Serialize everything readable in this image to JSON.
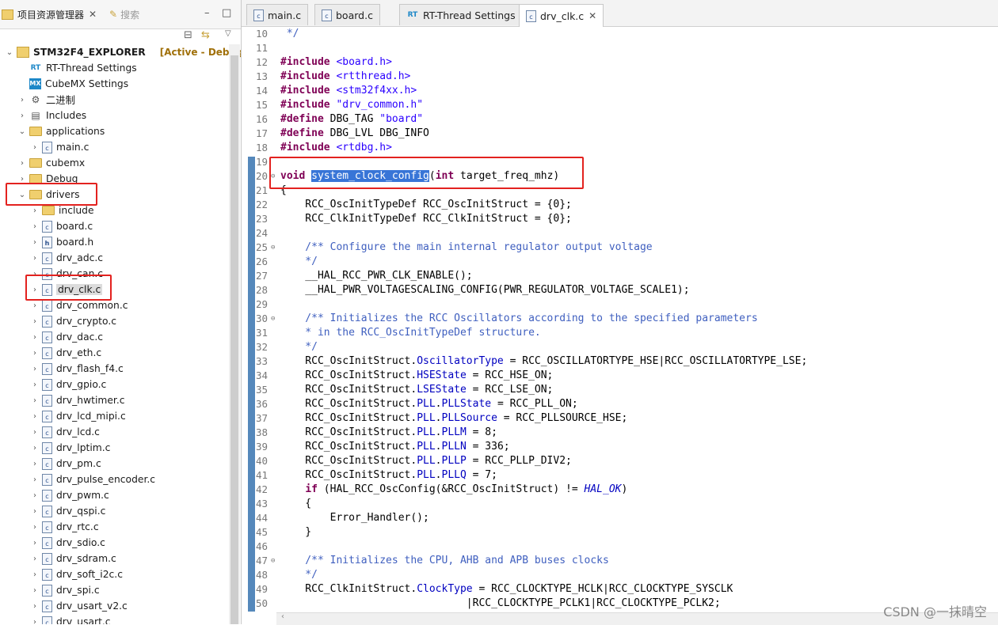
{
  "left_panel": {
    "tab_active": "项目资源管理器",
    "tab_inactive": "搜索",
    "minimize_glyph": "–",
    "maximize_glyph": "□",
    "project_name": "STM32F4_EXPLORER",
    "project_status": "[Active - Debug]",
    "tree": [
      {
        "label": "RT-Thread Settings",
        "kind": "rt",
        "depth": 1,
        "twisty": ""
      },
      {
        "label": "CubeMX Settings",
        "kind": "mx",
        "depth": 1,
        "twisty": ""
      },
      {
        "label": "二进制",
        "kind": "binary",
        "depth": 1,
        "twisty": "›"
      },
      {
        "label": "Includes",
        "kind": "includes",
        "depth": 1,
        "twisty": "›"
      },
      {
        "label": "applications",
        "kind": "folder",
        "depth": 1,
        "twisty": "⌄"
      },
      {
        "label": "main.c",
        "kind": "c",
        "depth": 2,
        "twisty": "›"
      },
      {
        "label": "cubemx",
        "kind": "folder",
        "depth": 1,
        "twisty": "›"
      },
      {
        "label": "Debug",
        "kind": "folder",
        "depth": 1,
        "twisty": "›"
      },
      {
        "label": "drivers",
        "kind": "folder",
        "depth": 1,
        "twisty": "⌄"
      },
      {
        "label": "include",
        "kind": "folder",
        "depth": 2,
        "twisty": "›"
      },
      {
        "label": "board.c",
        "kind": "c",
        "depth": 2,
        "twisty": "›"
      },
      {
        "label": "board.h",
        "kind": "h",
        "depth": 2,
        "twisty": "›"
      },
      {
        "label": "drv_adc.c",
        "kind": "c",
        "depth": 2,
        "twisty": "›"
      },
      {
        "label": "drv_can.c",
        "kind": "c",
        "depth": 2,
        "twisty": "›"
      },
      {
        "label": "drv_clk.c",
        "kind": "c",
        "depth": 2,
        "twisty": "›"
      },
      {
        "label": "drv_common.c",
        "kind": "c",
        "depth": 2,
        "twisty": "›"
      },
      {
        "label": "drv_crypto.c",
        "kind": "c",
        "depth": 2,
        "twisty": "›"
      },
      {
        "label": "drv_dac.c",
        "kind": "c",
        "depth": 2,
        "twisty": "›"
      },
      {
        "label": "drv_eth.c",
        "kind": "c",
        "depth": 2,
        "twisty": "›"
      },
      {
        "label": "drv_flash_f4.c",
        "kind": "c",
        "depth": 2,
        "twisty": "›"
      },
      {
        "label": "drv_gpio.c",
        "kind": "c",
        "depth": 2,
        "twisty": "›"
      },
      {
        "label": "drv_hwtimer.c",
        "kind": "c",
        "depth": 2,
        "twisty": "›"
      },
      {
        "label": "drv_lcd_mipi.c",
        "kind": "c",
        "depth": 2,
        "twisty": "›"
      },
      {
        "label": "drv_lcd.c",
        "kind": "c",
        "depth": 2,
        "twisty": "›"
      },
      {
        "label": "drv_lptim.c",
        "kind": "c",
        "depth": 2,
        "twisty": "›"
      },
      {
        "label": "drv_pm.c",
        "kind": "c",
        "depth": 2,
        "twisty": "›"
      },
      {
        "label": "drv_pulse_encoder.c",
        "kind": "c",
        "depth": 2,
        "twisty": "›"
      },
      {
        "label": "drv_pwm.c",
        "kind": "c",
        "depth": 2,
        "twisty": "›"
      },
      {
        "label": "drv_qspi.c",
        "kind": "c",
        "depth": 2,
        "twisty": "›"
      },
      {
        "label": "drv_rtc.c",
        "kind": "c",
        "depth": 2,
        "twisty": "›"
      },
      {
        "label": "drv_sdio.c",
        "kind": "c",
        "depth": 2,
        "twisty": "›"
      },
      {
        "label": "drv_sdram.c",
        "kind": "c",
        "depth": 2,
        "twisty": "›"
      },
      {
        "label": "drv_soft_i2c.c",
        "kind": "c",
        "depth": 2,
        "twisty": "›"
      },
      {
        "label": "drv_spi.c",
        "kind": "c",
        "depth": 2,
        "twisty": "›"
      },
      {
        "label": "drv_usart_v2.c",
        "kind": "c",
        "depth": 2,
        "twisty": "›"
      },
      {
        "label": "drv_usart.c",
        "kind": "c",
        "depth": 2,
        "twisty": "›"
      }
    ]
  },
  "editor": {
    "tabs": [
      {
        "label": "main.c",
        "active": false
      },
      {
        "label": "board.c",
        "active": false
      },
      {
        "label": "RT-Thread Settings",
        "active": false
      },
      {
        "label": "drv_clk.c",
        "active": true
      }
    ],
    "close_glyph": "✕",
    "lines": [
      {
        "n": "10",
        "fold": "",
        "segs": [
          [
            " */",
            "cm"
          ]
        ]
      },
      {
        "n": "11",
        "fold": "",
        "segs": []
      },
      {
        "n": "12",
        "fold": "",
        "segs": [
          [
            "#include",
            "kw"
          ],
          [
            " ",
            ""
          ],
          [
            "<board.h>",
            "str"
          ]
        ]
      },
      {
        "n": "13",
        "fold": "",
        "segs": [
          [
            "#include",
            "kw"
          ],
          [
            " ",
            ""
          ],
          [
            "<rtthread.h>",
            "str"
          ]
        ]
      },
      {
        "n": "14",
        "fold": "",
        "segs": [
          [
            "#include",
            "kw"
          ],
          [
            " ",
            ""
          ],
          [
            "<stm32f4xx.h>",
            "str"
          ]
        ]
      },
      {
        "n": "15",
        "fold": "",
        "segs": [
          [
            "#include",
            "kw"
          ],
          [
            " ",
            ""
          ],
          [
            "\"drv_common.h\"",
            "str"
          ]
        ]
      },
      {
        "n": "16",
        "fold": "",
        "segs": [
          [
            "#define",
            "kw"
          ],
          [
            " DBG_TAG ",
            ""
          ],
          [
            "\"board\"",
            "str"
          ]
        ]
      },
      {
        "n": "17",
        "fold": "",
        "segs": [
          [
            "#define",
            "kw"
          ],
          [
            " DBG_LVL DBG_INFO",
            ""
          ]
        ]
      },
      {
        "n": "18",
        "fold": "",
        "segs": [
          [
            "#include",
            "kw"
          ],
          [
            " ",
            ""
          ],
          [
            "<rtdbg.h>",
            "str"
          ]
        ]
      },
      {
        "n": "19",
        "fold": "",
        "segs": []
      },
      {
        "n": "20",
        "fold": "⊖",
        "segs": [
          [
            "void",
            "kw"
          ],
          [
            " ",
            ""
          ],
          [
            "system_clock_config",
            "sel"
          ],
          [
            "(",
            ""
          ],
          [
            "int",
            "kw"
          ],
          [
            " target_freq_mhz)",
            ""
          ]
        ]
      },
      {
        "n": "21",
        "fold": "",
        "segs": [
          [
            "{",
            ""
          ]
        ]
      },
      {
        "n": "22",
        "fold": "",
        "segs": [
          [
            "    RCC_OscInitTypeDef RCC_OscInitStruct = {0};",
            ""
          ]
        ]
      },
      {
        "n": "23",
        "fold": "",
        "segs": [
          [
            "    RCC_ClkInitTypeDef RCC_ClkInitStruct = {0};",
            ""
          ]
        ]
      },
      {
        "n": "24",
        "fold": "",
        "segs": []
      },
      {
        "n": "25",
        "fold": "⊖",
        "segs": [
          [
            "    /** Configure the main internal regulator output voltage",
            "cm"
          ]
        ]
      },
      {
        "n": "26",
        "fold": "",
        "segs": [
          [
            "    */",
            "cm"
          ]
        ]
      },
      {
        "n": "27",
        "fold": "",
        "segs": [
          [
            "    __HAL_RCC_PWR_CLK_ENABLE();",
            ""
          ]
        ]
      },
      {
        "n": "28",
        "fold": "",
        "segs": [
          [
            "    __HAL_PWR_VOLTAGESCALING_CONFIG(PWR_REGULATOR_VOLTAGE_SCALE1);",
            ""
          ]
        ]
      },
      {
        "n": "29",
        "fold": "",
        "segs": []
      },
      {
        "n": "30",
        "fold": "⊖",
        "segs": [
          [
            "    /** Initializes the RCC Oscillators according to the specified parameters",
            "cm"
          ]
        ]
      },
      {
        "n": "31",
        "fold": "",
        "segs": [
          [
            "    * in the RCC_OscInitTypeDef structure.",
            "cm"
          ]
        ]
      },
      {
        "n": "32",
        "fold": "",
        "segs": [
          [
            "    */",
            "cm"
          ]
        ]
      },
      {
        "n": "33",
        "fold": "",
        "segs": [
          [
            "    RCC_OscInitStruct.",
            ""
          ],
          [
            "OscillatorType",
            "fld"
          ],
          [
            " = RCC_OSCILLATORTYPE_HSE|RCC_OSCILLATORTYPE_LSE;",
            ""
          ]
        ]
      },
      {
        "n": "34",
        "fold": "",
        "segs": [
          [
            "    RCC_OscInitStruct.",
            ""
          ],
          [
            "HSEState",
            "fld"
          ],
          [
            " = RCC_HSE_ON;",
            ""
          ]
        ]
      },
      {
        "n": "35",
        "fold": "",
        "segs": [
          [
            "    RCC_OscInitStruct.",
            ""
          ],
          [
            "LSEState",
            "fld"
          ],
          [
            " = RCC_LSE_ON;",
            ""
          ]
        ]
      },
      {
        "n": "36",
        "fold": "",
        "segs": [
          [
            "    RCC_OscInitStruct.",
            ""
          ],
          [
            "PLL",
            "fld"
          ],
          [
            ".",
            ""
          ],
          [
            "PLLState",
            "fld"
          ],
          [
            " = RCC_PLL_ON;",
            ""
          ]
        ]
      },
      {
        "n": "37",
        "fold": "",
        "segs": [
          [
            "    RCC_OscInitStruct.",
            ""
          ],
          [
            "PLL",
            "fld"
          ],
          [
            ".",
            ""
          ],
          [
            "PLLSource",
            "fld"
          ],
          [
            " = RCC_PLLSOURCE_HSE;",
            ""
          ]
        ]
      },
      {
        "n": "38",
        "fold": "",
        "segs": [
          [
            "    RCC_OscInitStruct.",
            ""
          ],
          [
            "PLL",
            "fld"
          ],
          [
            ".",
            ""
          ],
          [
            "PLLM",
            "fld"
          ],
          [
            " = 8;",
            ""
          ]
        ]
      },
      {
        "n": "39",
        "fold": "",
        "segs": [
          [
            "    RCC_OscInitStruct.",
            ""
          ],
          [
            "PLL",
            "fld"
          ],
          [
            ".",
            ""
          ],
          [
            "PLLN",
            "fld"
          ],
          [
            " = 336;",
            ""
          ]
        ]
      },
      {
        "n": "40",
        "fold": "",
        "segs": [
          [
            "    RCC_OscInitStruct.",
            ""
          ],
          [
            "PLL",
            "fld"
          ],
          [
            ".",
            ""
          ],
          [
            "PLLP",
            "fld"
          ],
          [
            " = RCC_PLLP_DIV2;",
            ""
          ]
        ]
      },
      {
        "n": "41",
        "fold": "",
        "segs": [
          [
            "    RCC_OscInitStruct.",
            ""
          ],
          [
            "PLL",
            "fld"
          ],
          [
            ".",
            ""
          ],
          [
            "PLLQ",
            "fld"
          ],
          [
            " = 7;",
            ""
          ]
        ]
      },
      {
        "n": "42",
        "fold": "",
        "segs": [
          [
            "    ",
            ""
          ],
          [
            "if",
            "kw"
          ],
          [
            " (HAL_RCC_OscConfig(&RCC_OscInitStruct) != ",
            ""
          ],
          [
            "HAL_OK",
            "it"
          ],
          [
            ")",
            ""
          ]
        ]
      },
      {
        "n": "43",
        "fold": "",
        "segs": [
          [
            "    {",
            ""
          ]
        ]
      },
      {
        "n": "44",
        "fold": "",
        "segs": [
          [
            "        Error_Handler();",
            ""
          ]
        ]
      },
      {
        "n": "45",
        "fold": "",
        "segs": [
          [
            "    }",
            ""
          ]
        ]
      },
      {
        "n": "46",
        "fold": "",
        "segs": []
      },
      {
        "n": "47",
        "fold": "⊖",
        "segs": [
          [
            "    /** Initializes the CPU, AHB and APB buses clocks",
            "cm"
          ]
        ]
      },
      {
        "n": "48",
        "fold": "",
        "segs": [
          [
            "    */",
            "cm"
          ]
        ]
      },
      {
        "n": "49",
        "fold": "",
        "segs": [
          [
            "    RCC_ClkInitStruct.",
            ""
          ],
          [
            "ClockType",
            "fld"
          ],
          [
            " = RCC_CLOCKTYPE_HCLK|RCC_CLOCKTYPE_SYSCLK",
            ""
          ]
        ]
      },
      {
        "n": "50",
        "fold": "",
        "segs": [
          [
            "                              |RCC_CLOCKTYPE_PCLK1|RCC_CLOCKTYPE_PCLK2;",
            ""
          ]
        ]
      }
    ]
  },
  "watermark": "CSDN @一抹晴空",
  "colors": {
    "highlight_box": "#e3221f",
    "selection": "#3875d7",
    "keyword": "#7f0055",
    "string": "#2a00ff",
    "comment": "#3f5fbf",
    "field": "#0000c0"
  }
}
